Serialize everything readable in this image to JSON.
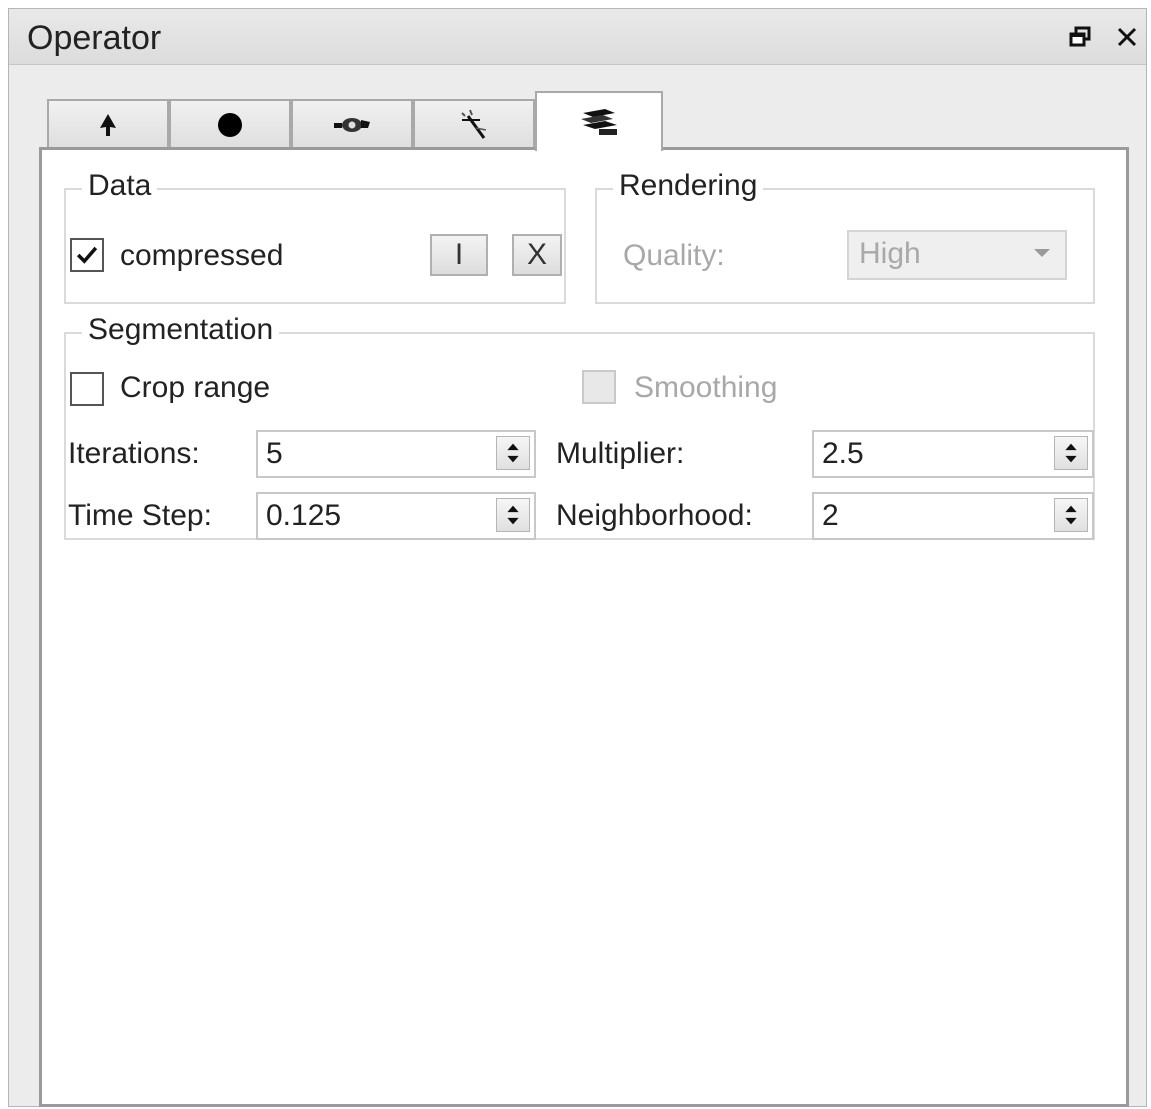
{
  "window": {
    "title": "Operator",
    "float_icon": "float-window-icon",
    "close_icon": "close-icon"
  },
  "tabs": [
    {
      "icon": "pointer-arrow-icon",
      "active": false
    },
    {
      "icon": "filled-circle-icon",
      "active": false
    },
    {
      "icon": "brush-icon",
      "active": false
    },
    {
      "icon": "magic-wand-icon",
      "active": false
    },
    {
      "icon": "layers-stack-icon",
      "active": true
    }
  ],
  "data_group": {
    "legend": "Data",
    "compressed_label": "compressed",
    "compressed_checked": true,
    "button_i": "I",
    "button_x": "X"
  },
  "rendering_group": {
    "legend": "Rendering",
    "quality_label": "Quality:",
    "quality_value": "High",
    "disabled": true
  },
  "segmentation_group": {
    "legend": "Segmentation",
    "crop_range_label": "Crop range",
    "crop_range_checked": false,
    "smoothing_label": "Smoothing",
    "smoothing_checked": false,
    "smoothing_disabled": true,
    "iterations_label": "Iterations:",
    "iterations_value": "5",
    "multiplier_label": "Multiplier:",
    "multiplier_value": "2.5",
    "time_step_label": "Time Step:",
    "time_step_value": "0.125",
    "neighborhood_label": "Neighborhood:",
    "neighborhood_value": "2"
  },
  "colors": {
    "panel_bg": "#ececec",
    "content_bg": "#ffffff",
    "disabled_text": "#a8a8a8"
  }
}
